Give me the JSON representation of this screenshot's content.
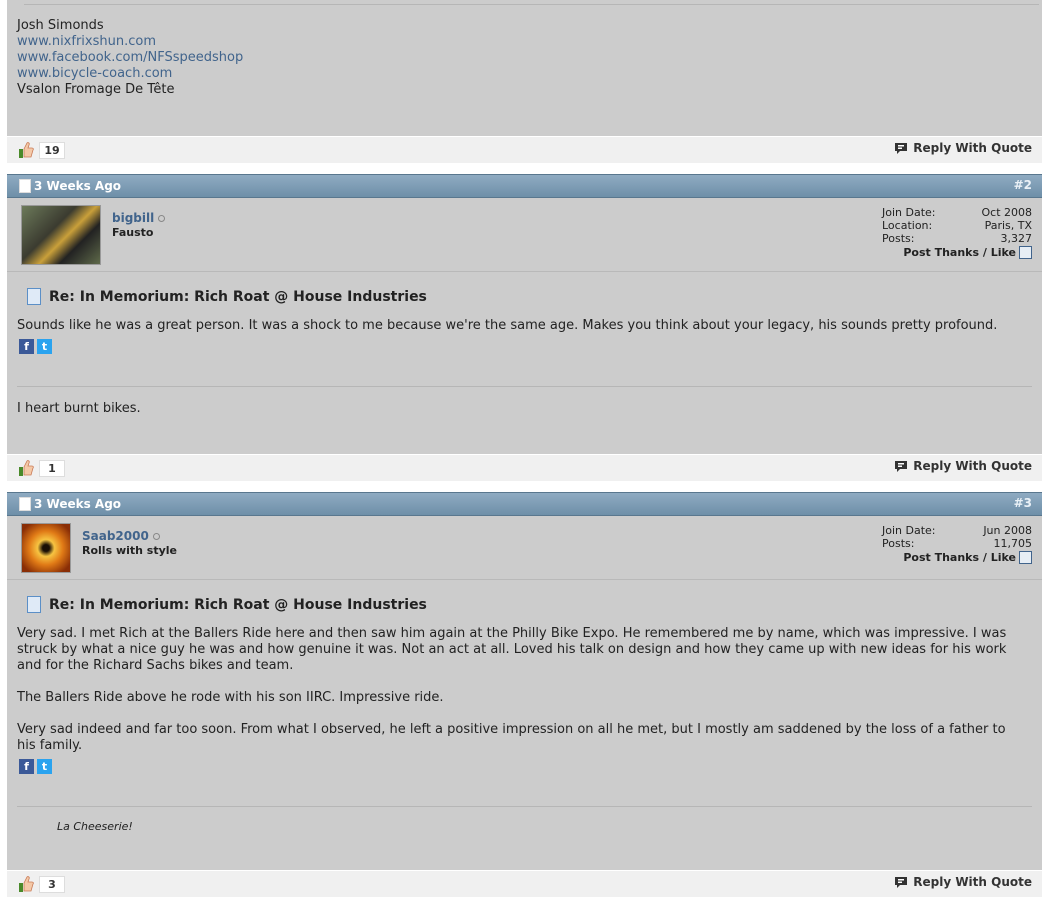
{
  "post1": {
    "signature": {
      "name": "Josh Simonds",
      "links": [
        "www.nixfrixshun.com",
        "www.facebook.com/NFSspeedshop",
        "www.bicycle-coach.com"
      ],
      "tagline": "Vsalon Fromage De Tête"
    },
    "likes": "19",
    "reply_label": "Reply With Quote"
  },
  "post2": {
    "date": "3 Weeks Ago",
    "number": "#2",
    "username": "bigbill",
    "user_title": "Fausto",
    "stats": [
      {
        "label": "Join Date:",
        "value": "Oct 2008"
      },
      {
        "label": "Location:",
        "value": "Paris, TX"
      },
      {
        "label": "Posts:",
        "value": "3,327"
      }
    ],
    "post_thanks": "Post Thanks / Like",
    "title": "Re: In Memorium: Rich Roat @ House Industries",
    "body": "Sounds like he was a great person. It was a shock to me because we're the same age. Makes you think about your legacy, his sounds pretty profound.",
    "signature": "I heart burnt bikes.",
    "likes": "1",
    "reply_label": "Reply With Quote"
  },
  "post3": {
    "date": "3 Weeks Ago",
    "number": "#3",
    "username": "Saab2000",
    "user_title": "Rolls with style",
    "stats": [
      {
        "label": "Join Date:",
        "value": "Jun 2008"
      },
      {
        "label": "Posts:",
        "value": "11,705"
      }
    ],
    "post_thanks": "Post Thanks / Like",
    "title": "Re: In Memorium: Rich Roat @ House Industries",
    "paragraphs": [
      "Very sad. I met Rich at the Ballers Ride here and then saw him again at the Philly Bike Expo. He remembered me by name, which was impressive. I was struck by what a nice guy he was and how genuine it was. Not an act at all. Loved his talk on design and how they came up with new ideas for his work and for the Richard Sachs bikes and team.",
      "The Ballers Ride above he rode with his son IIRC. Impressive ride.",
      "Very sad indeed and far too soon. From what I observed, he left a positive impression on all he met, but I mostly am saddened by the loss of a father to his family."
    ],
    "signature": "La Cheeserie!",
    "likes": "3",
    "reply_label": "Reply With Quote"
  },
  "share": {
    "facebook": "f",
    "twitter": "t"
  },
  "colors": {
    "header_bar": "#7f9db6",
    "post_bg": "#cccccc",
    "link": "#41648c"
  }
}
